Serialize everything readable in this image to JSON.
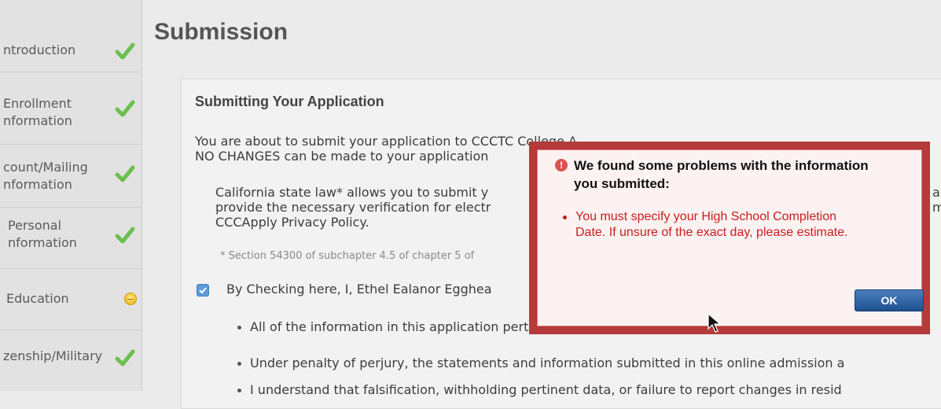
{
  "sidebar": {
    "items": [
      {
        "label": "ntroduction",
        "status": "complete"
      },
      {
        "label": "Enrollment\nnformation",
        "status": "complete"
      },
      {
        "label": "count/Mailing\nnformation",
        "status": "complete"
      },
      {
        "label": "Personal\nnformation",
        "status": "complete"
      },
      {
        "label": "Education",
        "status": "in-progress"
      },
      {
        "label": "zenship/Military",
        "status": "complete"
      }
    ]
  },
  "main": {
    "title": "Submission",
    "section_title": "Submitting Your Application",
    "intro_line1": "You are about to submit your application to CCCTC College A.",
    "intro_line2": "NO CHANGES can be made to your application",
    "law_line1": "California state law* allows you to submit y",
    "law_line2": "provide the necessary verification for electr",
    "law_line3": "CCCApply Privacy Policy.",
    "law_right1": "a",
    "law_right2": "m",
    "footnote": "* Section 54300 of subchapter 4.5 of chapter 5 of",
    "checkbox_label": "By Checking here, I, Ethel Ealanor Egghea",
    "checkbox_checked": true,
    "bullets": [
      "All of the information in this application pertains to me.",
      "Under penalty of perjury, the statements and information submitted in this online admission a",
      "I understand that falsification, withholding pertinent data, or failure to report changes in resid"
    ]
  },
  "dialog": {
    "heading": "We found some problems with the information you submitted:",
    "errors": [
      "You must specify your High School Completion Date. If unsure of the exact day, please estimate."
    ],
    "ok_label": "OK"
  },
  "colors": {
    "check_green": "#6cbf4f",
    "dialog_frame": "#b53a3a",
    "error_text": "#c81d1d",
    "ok_button": "#2a5a9a",
    "checkbox_blue": "#5b9bd8"
  }
}
